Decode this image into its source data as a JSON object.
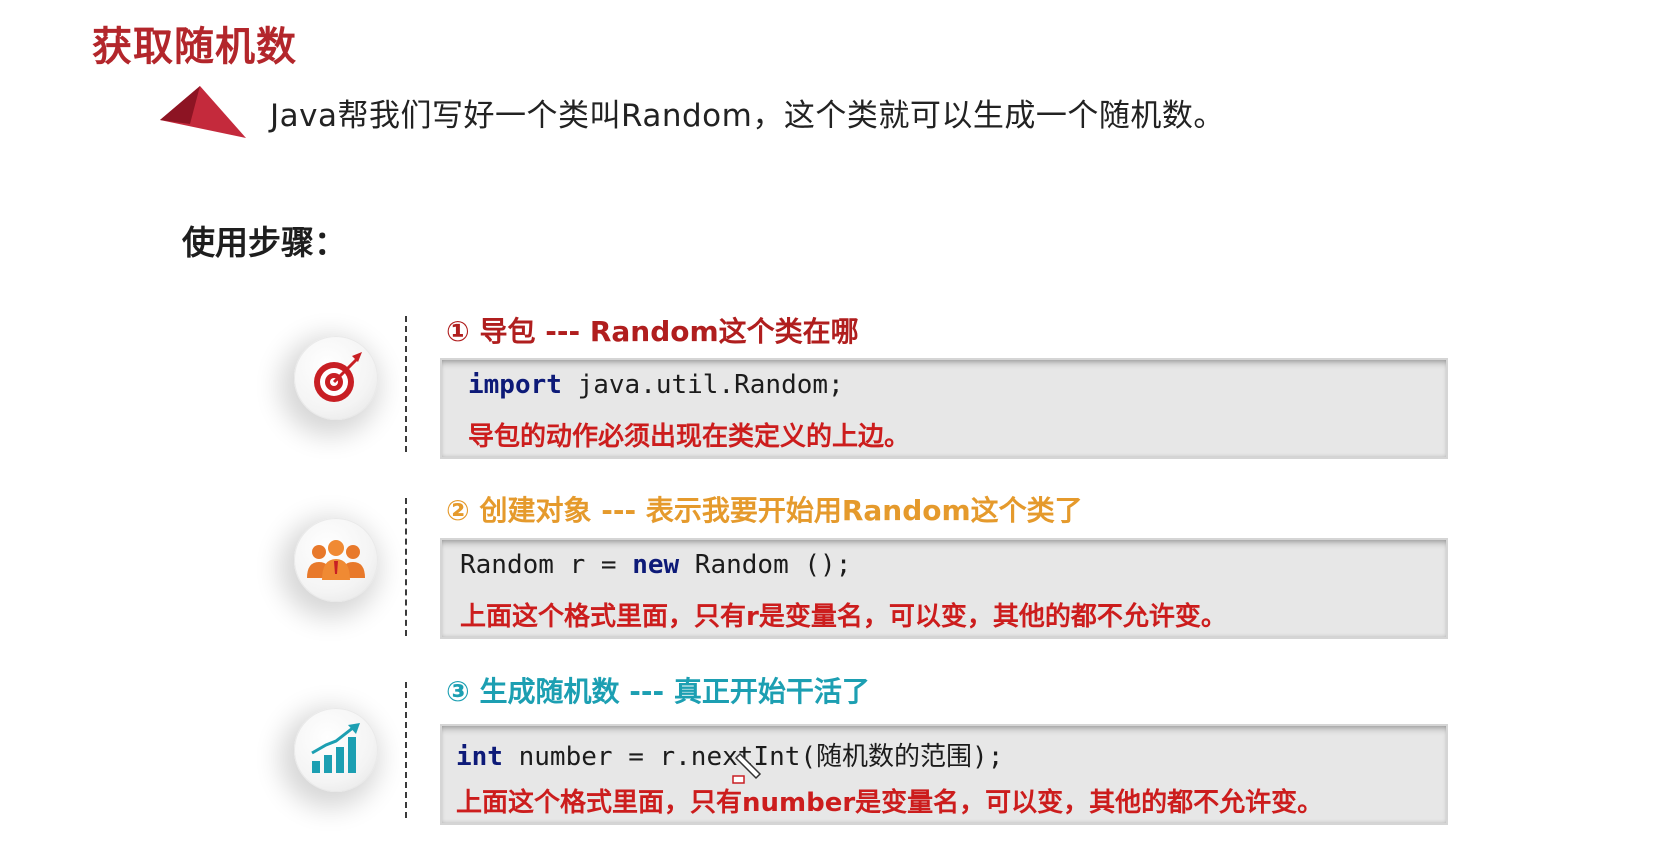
{
  "title": "获取随机数",
  "intro": "Java帮我们写好一个类叫Random，这个类就可以生成一个随机数。",
  "steps_heading": "使用步骤：",
  "colors": {
    "title": "#b3262b",
    "step1": "#b01e1e",
    "step2": "#e59a2c",
    "step3": "#1c9fb2",
    "note": "#cc1d1d",
    "keyword": "#0d1a78"
  },
  "steps": [
    {
      "icon": "target-icon",
      "title": "① 导包  ---  Random这个类在哪",
      "code_keyword": "import",
      "code_rest": " java.util.Random;",
      "note": "导包的动作必须出现在类定义的上边。"
    },
    {
      "icon": "team-icon",
      "title": "② 创建对象 --- 表示我要开始用Random这个类了",
      "code_before": "Random r = ",
      "code_keyword": "new",
      "code_after": " Random ();",
      "note": "上面这个格式里面，只有r是变量名，可以变，其他的都不允许变。"
    },
    {
      "icon": "growth-chart-icon",
      "title": "③ 生成随机数 --- 真正开始干活了",
      "code_keyword": "int",
      "code_rest": " number = r.nextInt(随机数的范围);",
      "note": "上面这个格式里面，只有number是变量名，可以变，其他的都不允许变。"
    }
  ]
}
